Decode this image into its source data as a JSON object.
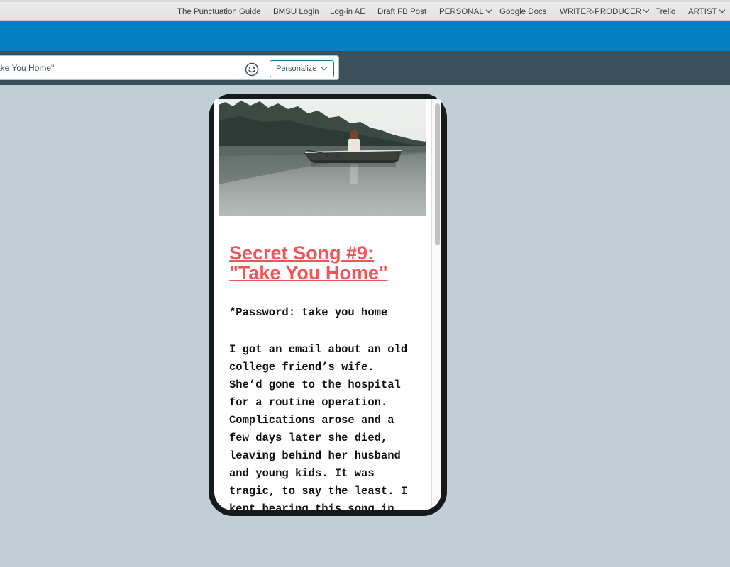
{
  "bookmarks": {
    "items": [
      {
        "label": "The Punctuation Guide",
        "dropdown": false
      },
      {
        "label": "BMSU Login",
        "dropdown": false
      },
      {
        "label": "Log-in AE",
        "dropdown": false
      },
      {
        "label": "Draft FB Post",
        "dropdown": false
      },
      {
        "label": "PERSONAL",
        "dropdown": true
      },
      {
        "label": "Google Docs",
        "dropdown": false
      },
      {
        "label": "WRITER-PRODUCER",
        "dropdown": true
      },
      {
        "label": "Trello",
        "dropdown": false
      },
      {
        "label": "ARTIST",
        "dropdown": true
      }
    ]
  },
  "toolbar": {
    "title_value": "ake You Home\"",
    "smiley_icon": "emoji-smiley-icon",
    "personalize_label": "Personalize"
  },
  "colors": {
    "header_blue": "#0380c3",
    "toolbar_dark": "#3a515c",
    "page_bg": "#c0ced5",
    "title_red": "#f2555a"
  },
  "preview": {
    "hero_image": "woman-in-rowboat-on-misty-lake",
    "title_line1": "Secret Song #9:",
    "title_line2": "\"Take You Home\"",
    "password_line": "*Password: take you home",
    "body_lines": [
      "I got an email about an old",
      "college friend’s wife.",
      "She’d gone to the hospital",
      "for a routine operation.",
      "Complications arose and a",
      "few days later she died,",
      "leaving behind her husband",
      "and young kids. It was",
      "tragic, to say the least. I",
      "kept hearing this song in"
    ]
  }
}
